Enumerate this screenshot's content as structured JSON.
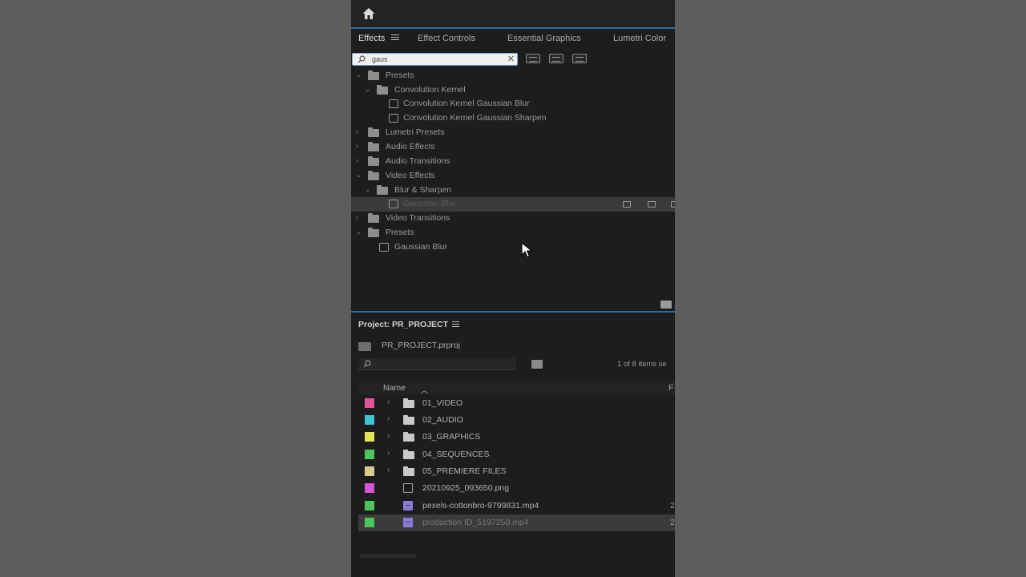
{
  "effects": {
    "tabs": [
      "Effects",
      "Effect Controls",
      "Essential Graphics",
      "Lumetri Color"
    ],
    "search_value": "gaus",
    "tree": [
      {
        "label": "Presets",
        "level": 0,
        "expanded": true,
        "kind": "preset-folder"
      },
      {
        "label": "Convolution Kernel",
        "level": 1,
        "expanded": true,
        "kind": "preset-folder"
      },
      {
        "label": "Convolution Kernel Gaussian Blur",
        "level": 2,
        "kind": "preset"
      },
      {
        "label": "Convolution Kernel Gaussian Sharpen",
        "level": 2,
        "kind": "preset"
      },
      {
        "label": "Lumetri Presets",
        "level": 0,
        "expanded": false,
        "kind": "preset-folder"
      },
      {
        "label": "Audio Effects",
        "level": 0,
        "expanded": false,
        "kind": "folder"
      },
      {
        "label": "Audio Transitions",
        "level": 0,
        "expanded": false,
        "kind": "folder"
      },
      {
        "label": "Video Effects",
        "level": 0,
        "expanded": true,
        "kind": "folder"
      },
      {
        "label": "Blur & Sharpen",
        "level": 1,
        "expanded": true,
        "kind": "folder"
      },
      {
        "label": "Gaussian Blur",
        "level": 2,
        "kind": "effect",
        "selected": true
      },
      {
        "label": "Video Transitions",
        "level": 0,
        "expanded": false,
        "kind": "folder"
      },
      {
        "label": "Presets",
        "level": 0,
        "expanded": true,
        "kind": "folder"
      },
      {
        "label": "Gaussian Blur",
        "level": 1,
        "kind": "preset"
      }
    ]
  },
  "project": {
    "title": "Project: PR_PROJECT",
    "file": "PR_PROJECT.prproj",
    "search_value": "",
    "items_count": "1 of 8 items se",
    "col_name": "Name",
    "col_f": "F",
    "rows": [
      {
        "label": "01_VIDEO",
        "color": "#e0559a",
        "kind": "folder",
        "cut": ""
      },
      {
        "label": "02_AUDIO",
        "color": "#3fc3d3",
        "kind": "folder",
        "cut": ""
      },
      {
        "label": "03_GRAPHICS",
        "color": "#e3e35a",
        "kind": "folder",
        "cut": ""
      },
      {
        "label": "04_SEQUENCES",
        "color": "#4fc45a",
        "kind": "folder",
        "cut": ""
      },
      {
        "label": "05_PREMIERE FILES",
        "color": "#d8cd8a",
        "kind": "folder",
        "cut": ""
      },
      {
        "label": "20210925_093650.png",
        "color": "#d456d4",
        "kind": "image",
        "cut": ""
      },
      {
        "label": "pexels-cottonbro-9799831.mp4",
        "color": "#4fc45a",
        "kind": "video",
        "cut": "2"
      },
      {
        "label": "production ID_5197250.mp4",
        "color": "#4fc45a",
        "kind": "video",
        "cut": "2",
        "selected": true
      }
    ]
  }
}
